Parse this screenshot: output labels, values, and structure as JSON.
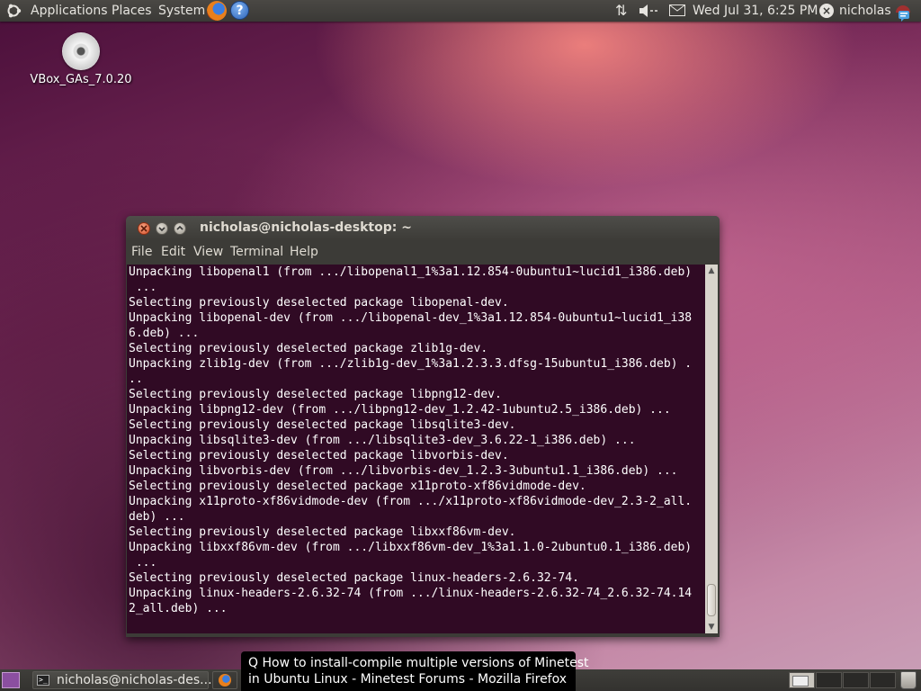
{
  "top_panel": {
    "menus": [
      "Applications",
      "Places",
      "System"
    ],
    "clock": "Wed Jul 31,  6:25 PM",
    "user": "nicholas"
  },
  "desktop": {
    "icons": [
      {
        "label": "VBox_GAs_7.0.20",
        "icon": "cd-icon"
      }
    ]
  },
  "terminal": {
    "title": "nicholas@nicholas-desktop: ~",
    "menus": [
      "File",
      "Edit",
      "View",
      "Terminal",
      "Help"
    ],
    "lines": [
      "Unpacking libopenal1 (from .../libopenal1_1%3a1.12.854-0ubuntu1~lucid1_i386.deb)",
      " ...",
      "Selecting previously deselected package libopenal-dev.",
      "Unpacking libopenal-dev (from .../libopenal-dev_1%3a1.12.854-0ubuntu1~lucid1_i38",
      "6.deb) ...",
      "Selecting previously deselected package zlib1g-dev.",
      "Unpacking zlib1g-dev (from .../zlib1g-dev_1%3a1.2.3.3.dfsg-15ubuntu1_i386.deb) .",
      "..",
      "Selecting previously deselected package libpng12-dev.",
      "Unpacking libpng12-dev (from .../libpng12-dev_1.2.42-1ubuntu2.5_i386.deb) ...",
      "Selecting previously deselected package libsqlite3-dev.",
      "Unpacking libsqlite3-dev (from .../libsqlite3-dev_3.6.22-1_i386.deb) ...",
      "Selecting previously deselected package libvorbis-dev.",
      "Unpacking libvorbis-dev (from .../libvorbis-dev_1.2.3-3ubuntu1.1_i386.deb) ...",
      "Selecting previously deselected package x11proto-xf86vidmode-dev.",
      "Unpacking x11proto-xf86vidmode-dev (from .../x11proto-xf86vidmode-dev_2.3-2_all.",
      "deb) ...",
      "Selecting previously deselected package libxxf86vm-dev.",
      "Unpacking libxxf86vm-dev (from .../libxxf86vm-dev_1%3a1.1.0-2ubuntu0.1_i386.deb)",
      " ...",
      "Selecting previously deselected package linux-headers-2.6.32-74.",
      "Unpacking linux-headers-2.6.32-74 (from .../linux-headers-2.6.32-74_2.6.32-74.14",
      "2_all.deb) ..."
    ],
    "colors": {
      "background": "#300a24",
      "text": "#ffffff"
    }
  },
  "taskbar": {
    "tasks": [
      {
        "label": "nicholas@nicholas-des...",
        "icon": "terminal-icon"
      },
      {
        "label": "",
        "icon": "firefox-icon"
      }
    ],
    "workspaces": 4
  },
  "tooltip": {
    "lines": [
      "Q How to install-compile multiple versions of Minetest",
      "in Ubuntu Linux - Minetest Forums - Mozilla Firefox"
    ]
  }
}
